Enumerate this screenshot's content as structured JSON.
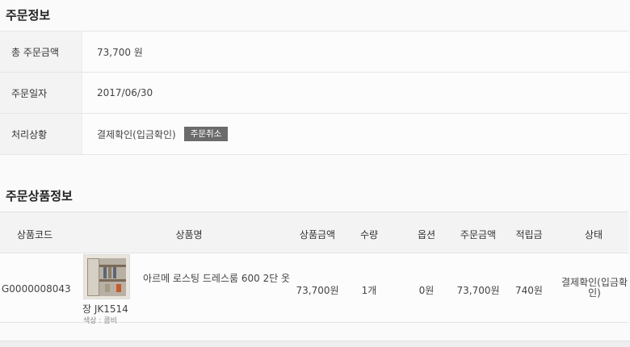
{
  "order_info": {
    "title": "주문정보",
    "rows": [
      {
        "label": "총 주문금액",
        "value": "73,700 원"
      },
      {
        "label": "주문일자",
        "value": "2017/06/30"
      },
      {
        "label": "처리상황",
        "value": "결제확인(입금확인)"
      }
    ],
    "cancel_button": "주문취소"
  },
  "products": {
    "title": "주문상품정보",
    "headers": {
      "code": "상품코드",
      "name": "상품명",
      "price": "상품금액",
      "qty": "수량",
      "option": "옵션",
      "order_amount": "주문금액",
      "points": "적립금",
      "status": "상태"
    },
    "items": [
      {
        "code": "G0000008043",
        "name_line1": "아르메 로스팅 드레스룸 600 2단 옷",
        "name_line2": "장 JK1514",
        "option_text": "색상 : 콤비",
        "price": "73,700원",
        "qty": "1개",
        "option": "0원",
        "order_amount": "73,700원",
        "points": "740원",
        "status_line1": "결제확인(입금확",
        "status_line2": "인)"
      }
    ]
  }
}
